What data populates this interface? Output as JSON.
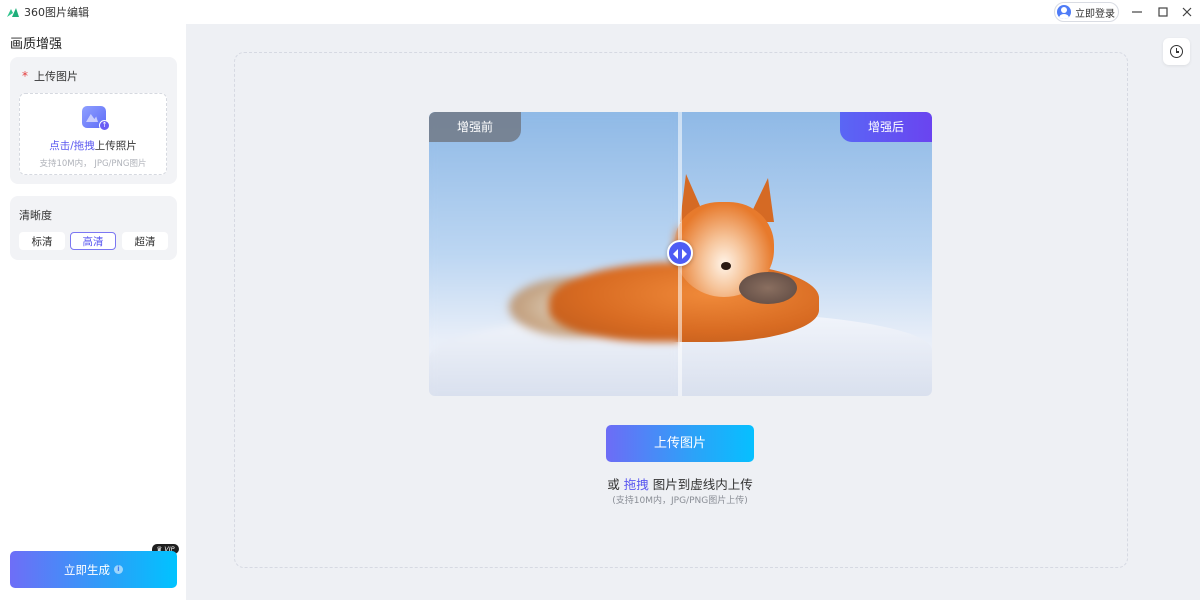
{
  "titlebar": {
    "app_title": "360图片编辑",
    "login_label": "立即登录",
    "icons": [
      "app-logo-icon",
      "user-avatar-icon",
      "minimize-icon",
      "maximize-icon",
      "close-icon"
    ]
  },
  "sidebar": {
    "title": "画质增强",
    "upload": {
      "required_mark": "*",
      "label": "上传图片",
      "link_text": "点击/拖拽",
      "action_text": "上传照片",
      "hint": "支持10M内， JPG/PNG图片"
    },
    "clarity": {
      "label": "清晰度",
      "options": [
        "标清",
        "高清",
        "超清"
      ],
      "selected": "高清"
    },
    "generate_label": "立即生成",
    "vip_badge": "VIP"
  },
  "main": {
    "history_icon": "history-clock-icon",
    "compare": {
      "before_label": "增强前",
      "after_label": "增强后",
      "slider_position_percent": 50
    },
    "upload_button": "上传图片",
    "or_prefix": "或",
    "drag_link": "拖拽",
    "or_suffix": "图片到虚线内上传",
    "support_text": "(支持10M内，JPG/PNG图片上传)"
  },
  "colors": {
    "accent": "#5a57f0",
    "gradient_start": "#6d6cf6",
    "gradient_end": "#06c0ff",
    "required_star": "#e43d3d"
  }
}
